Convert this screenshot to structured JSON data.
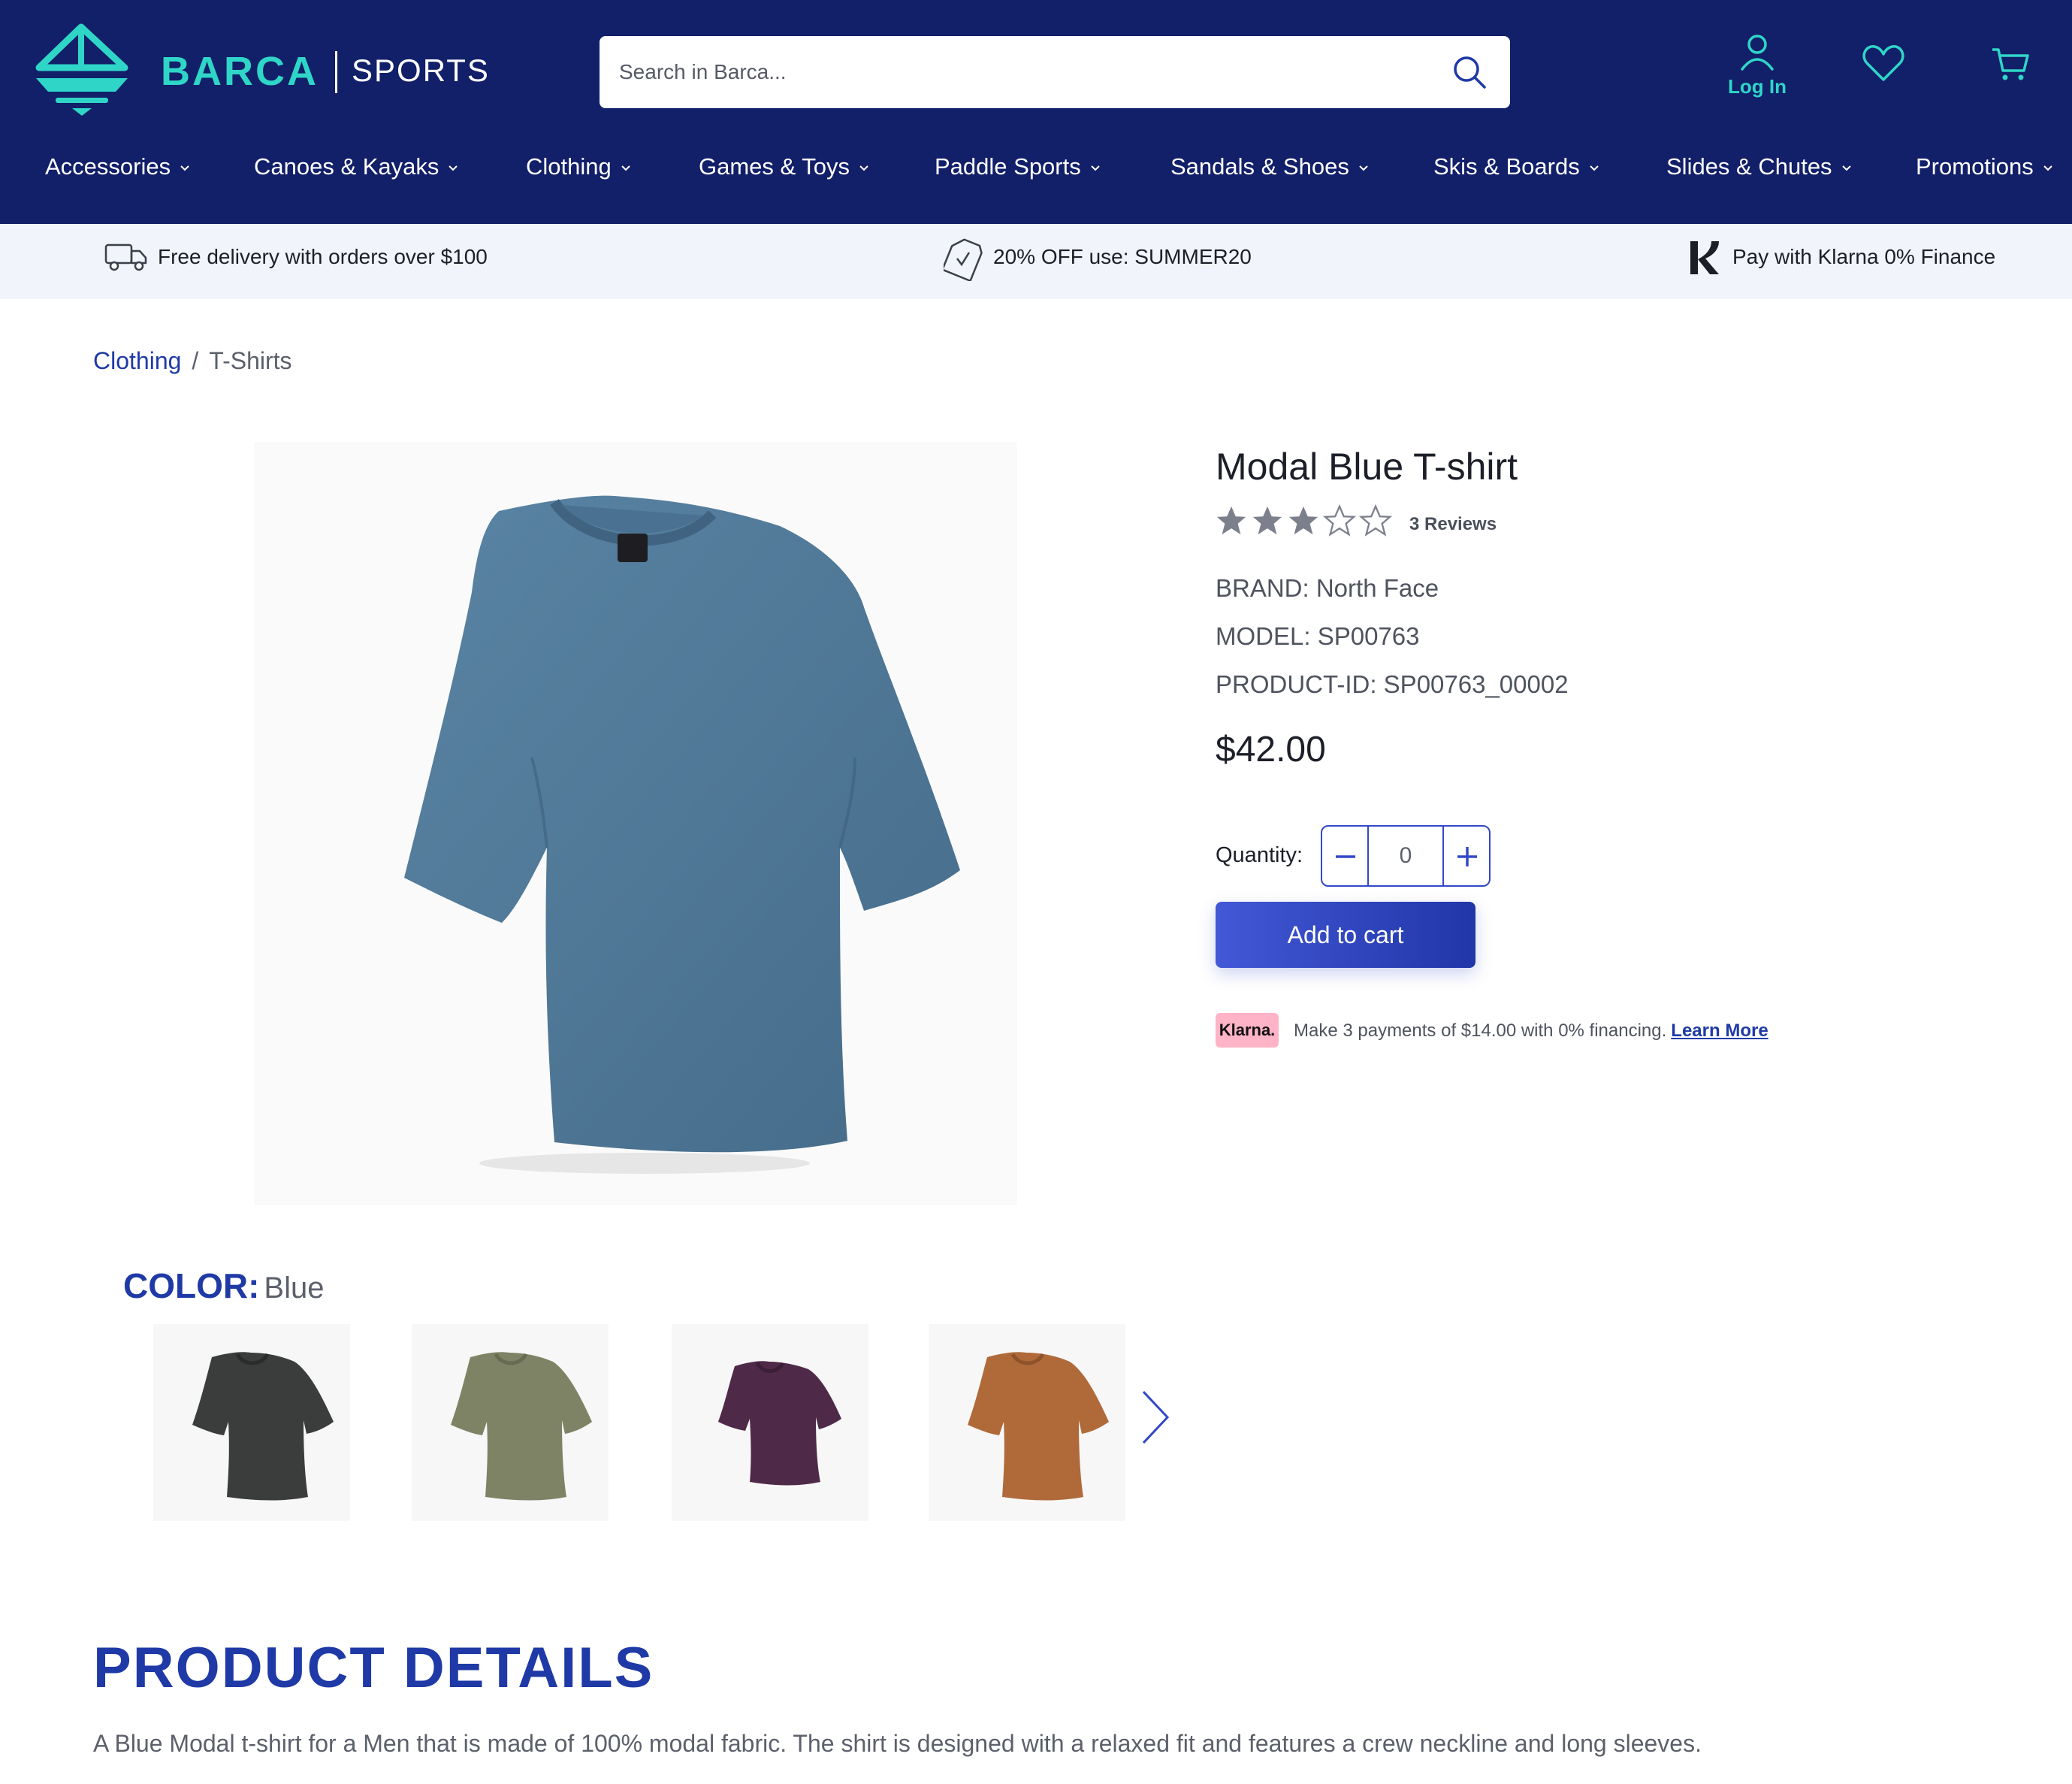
{
  "header": {
    "brand_name": "BARCA",
    "brand_sub": "SPORTS",
    "search_placeholder": "Search in Barca...",
    "login_label": "Log In",
    "icons": [
      "boat-logo-icon",
      "search-icon",
      "user-icon",
      "heart-icon",
      "cart-icon"
    ]
  },
  "nav": {
    "items": [
      {
        "label": "Accessories"
      },
      {
        "label": "Canoes & Kayaks"
      },
      {
        "label": "Clothing"
      },
      {
        "label": "Games & Toys"
      },
      {
        "label": "Paddle Sports"
      },
      {
        "label": "Sandals & Shoes"
      },
      {
        "label": "Skis & Boards"
      },
      {
        "label": "Slides & Chutes"
      },
      {
        "label": "Promotions"
      }
    ]
  },
  "promo": {
    "delivery": "Free delivery with orders over $100",
    "discount": "20% OFF use: SUMMER20",
    "klarna": "Pay with Klarna 0% Finance"
  },
  "breadcrumb": {
    "parent": "Clothing",
    "separator": "/",
    "current": "T-Shirts"
  },
  "product": {
    "title": "Modal Blue T-shirt",
    "rating": 3,
    "rating_max": 5,
    "reviews": "3 Reviews",
    "brand": "BRAND: North Face",
    "model": "MODEL: SP00763",
    "product_id": "PRODUCT-ID: SP00763_00002",
    "price": "$42.00",
    "quantity_label": "Quantity:",
    "quantity_value": "0",
    "add_to_cart": "Add to cart",
    "klarna_badge": "Klarna.",
    "klarna_text": "Make 3 payments of $14.00 with 0% financing.",
    "klarna_link": "Learn More",
    "main_image_color": "#4f7796"
  },
  "color": {
    "label": "COLOR:",
    "selected": "Blue",
    "swatches": [
      {
        "name": "charcoal",
        "hex": "#3a3d3c"
      },
      {
        "name": "olive",
        "hex": "#7f8366"
      },
      {
        "name": "plum",
        "hex": "#4e2a48"
      },
      {
        "name": "copper",
        "hex": "#b06a3a"
      }
    ]
  },
  "details": {
    "heading": "PRODUCT DETAILS",
    "description": "A Blue Modal t-shirt for a Men that is made of 100% modal fabric. The shirt is designed with a relaxed fit and features a crew neckline and long sleeves."
  },
  "colors": {
    "header_bg": "#121f69",
    "accent_teal": "#2fd6c7",
    "primary_blue": "#1f3aa6",
    "promo_bg": "#f1f4fa",
    "klarna_pink": "#ffb3c7"
  }
}
